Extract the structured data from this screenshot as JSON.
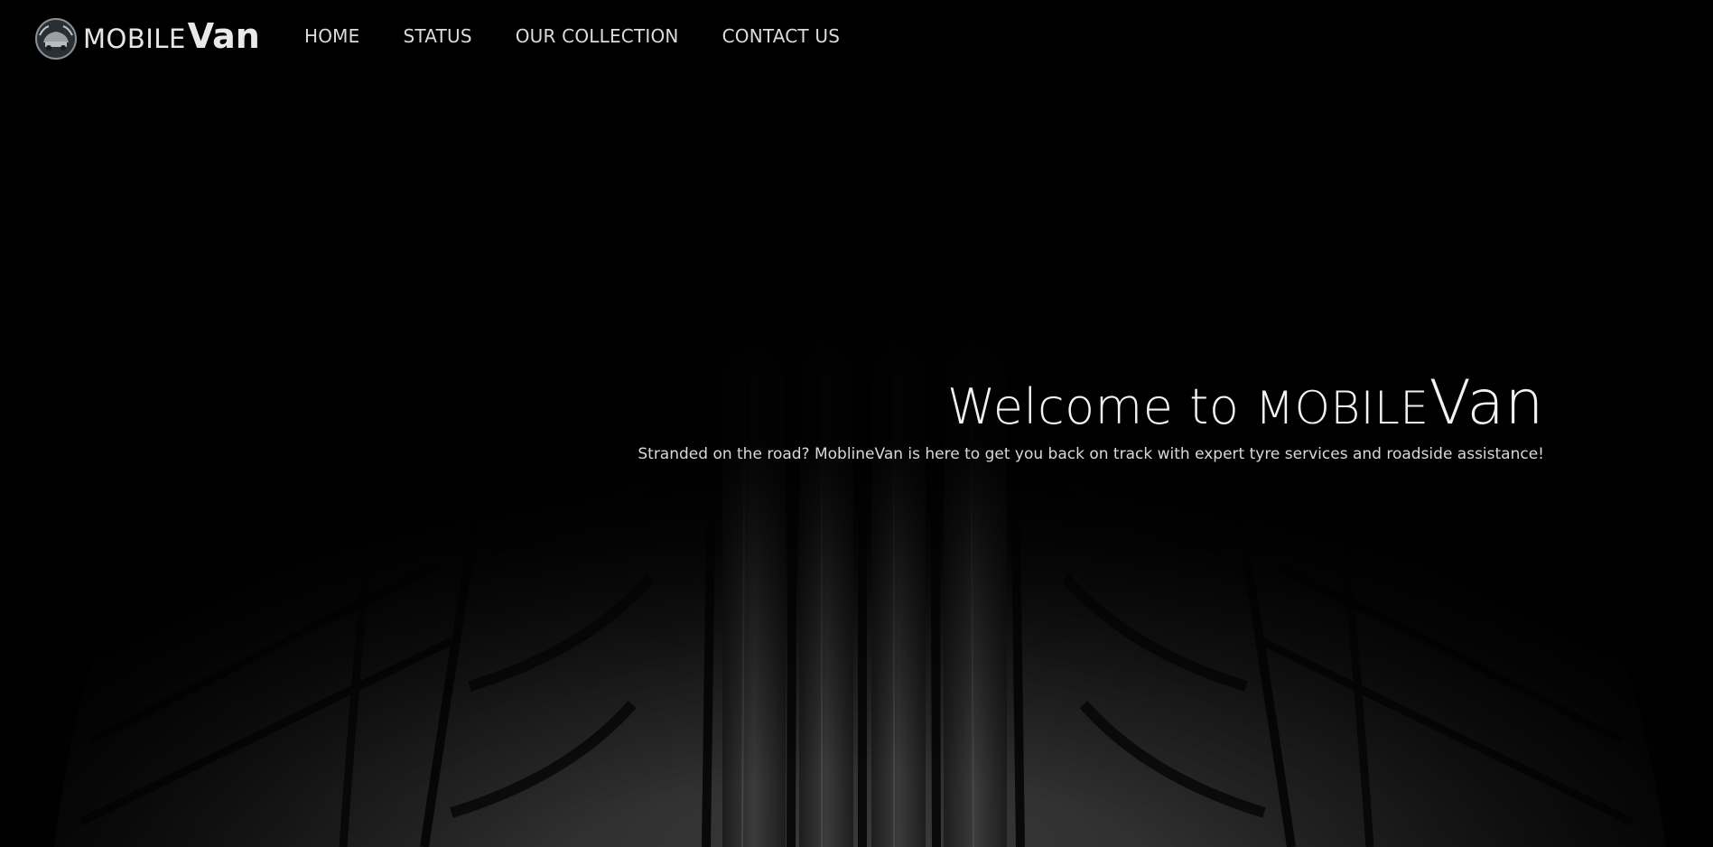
{
  "header": {
    "logo": {
      "text_main": "MOBILE",
      "text_bold": "Van",
      "emblem_icon": "car-emblem-icon"
    },
    "nav": [
      {
        "label": "HOME"
      },
      {
        "label": "STATUS"
      },
      {
        "label": "OUR COLLECTION"
      },
      {
        "label": "CONTACT US"
      }
    ]
  },
  "hero": {
    "title_prefix": "Welcome to ",
    "title_brand_small": "MOBILE",
    "title_brand_big": "Van",
    "subtitle": "Stranded on the road? MoblineVan is here to get you back on track with expert tyre services and roadside assistance!",
    "background_image": "black-tyre-tread-photo"
  },
  "colors": {
    "background": "#030303",
    "text_primary": "#f2f2f2",
    "nav_text": "#dcdcdc"
  }
}
